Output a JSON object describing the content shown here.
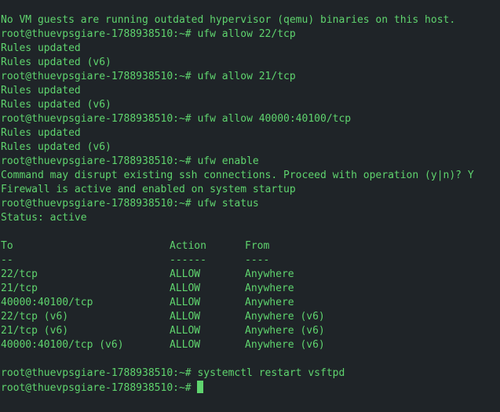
{
  "terminal": {
    "colors": {
      "background": "#1f2428",
      "foreground": "#5fd46e"
    },
    "lines_before_table": [
      "No VM guests are running outdated hypervisor (qemu) binaries on this host.",
      "root@thuevpsgiare-1788938510:~# ufw allow 22/tcp",
      "Rules updated",
      "Rules updated (v6)",
      "root@thuevpsgiare-1788938510:~# ufw allow 21/tcp",
      "Rules updated",
      "Rules updated (v6)",
      "root@thuevpsgiare-1788938510:~# ufw allow 40000:40100/tcp",
      "Rules updated",
      "Rules updated (v6)",
      "root@thuevpsgiare-1788938510:~# ufw enable",
      "Command may disrupt existing ssh connections. Proceed with operation (y|n)? Y",
      "Firewall is active and enabled on system startup",
      "root@thuevpsgiare-1788938510:~# ufw status",
      "Status: active",
      ""
    ],
    "table": {
      "headers": {
        "to": "To",
        "action": "Action",
        "from": "From"
      },
      "separators": {
        "to": "--",
        "action": "------",
        "from": "----"
      },
      "rows": [
        {
          "to": "22/tcp",
          "action": "ALLOW",
          "from": "Anywhere"
        },
        {
          "to": "21/tcp",
          "action": "ALLOW",
          "from": "Anywhere"
        },
        {
          "to": "40000:40100/tcp",
          "action": "ALLOW",
          "from": "Anywhere"
        },
        {
          "to": "22/tcp (v6)",
          "action": "ALLOW",
          "from": "Anywhere (v6)"
        },
        {
          "to": "21/tcp (v6)",
          "action": "ALLOW",
          "from": "Anywhere (v6)"
        },
        {
          "to": "40000:40100/tcp (v6)",
          "action": "ALLOW",
          "from": "Anywhere (v6)"
        }
      ]
    },
    "lines_after_table": [
      "",
      "root@thuevpsgiare-1788938510:~# systemctl restart vsftpd"
    ],
    "prompt": "root@thuevpsgiare-1788938510:~# "
  }
}
